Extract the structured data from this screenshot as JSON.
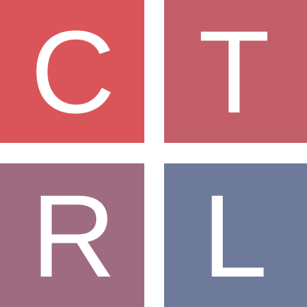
{
  "logo": {
    "tiles": [
      {
        "letter": "C",
        "color": "#d95559"
      },
      {
        "letter": "T",
        "color": "#c35f69"
      },
      {
        "letter": "R",
        "color": "#9e6b80"
      },
      {
        "letter": "L",
        "color": "#6e7a99"
      }
    ],
    "letter_color": "#ffffff",
    "background_color": "#ffffff"
  }
}
